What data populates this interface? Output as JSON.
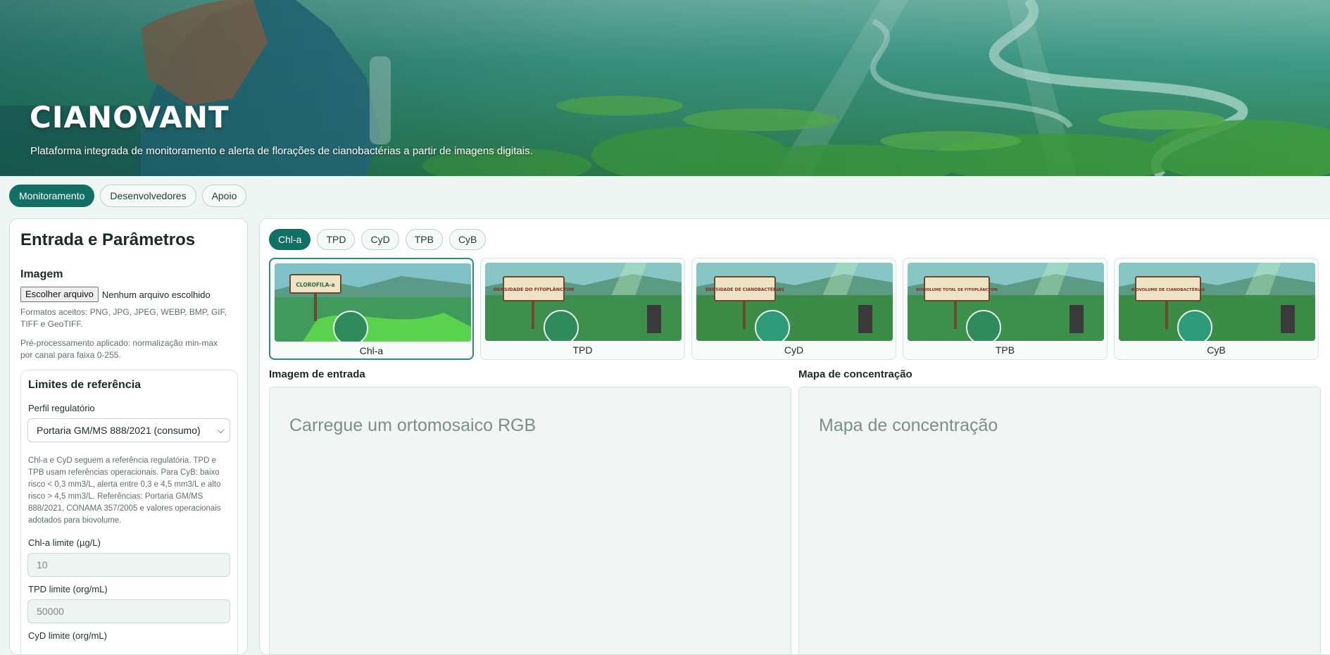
{
  "hero": {
    "title": "CIANOVANT",
    "subtitle": "Plataforma integrada de monitoramento e alerta de florações de cianobactérias a partir de imagens digitais."
  },
  "nav": {
    "tabs": [
      {
        "label": "Monitoramento",
        "active": true
      },
      {
        "label": "Desenvolvedores",
        "active": false
      },
      {
        "label": "Apoio",
        "active": false
      }
    ]
  },
  "left": {
    "title": "Entrada e Parâmetros",
    "image_section": "Imagem",
    "file_button": "Escolher arquivo",
    "file_status": "Nenhum arquivo escolhido",
    "formats_help": "Formatos aceitos: PNG, JPG, JPEG, WEBP, BMP, GIF, TIFF e GeoTIFF.",
    "preprocess_help": "Pré-processamento aplicado: normalização min-max por canal para faixa 0-255.",
    "limits": {
      "title": "Limites de referência",
      "profile_label": "Perfil regulatório",
      "profile_value": "Portaria GM/MS 888/2021 (consumo)",
      "help": "Chl-a e CyD seguem a referência regulatória. TPD e TPB usam referências operacionais. Para CyB: baixo risco < 0,3 mm3/L, alerta entre 0,3 e 4,5 mm3/L e alto risco > 4,5 mm3/L. Referências: Portaria GM/MS 888/2021, CONAMA 357/2005 e valores operacionais adotados para biovolume.",
      "chla_label": "Chl-a limite (µg/L)",
      "chla_value": "10",
      "tpd_label": "TPD limite (org/mL)",
      "tpd_value": "50000",
      "cyd_label": "CyD limite (org/mL)"
    }
  },
  "right": {
    "variable_tabs": [
      {
        "label": "Chl-a",
        "active": true
      },
      {
        "label": "TPD",
        "active": false
      },
      {
        "label": "CyD",
        "active": false
      },
      {
        "label": "TPB",
        "active": false
      },
      {
        "label": "CyB",
        "active": false
      }
    ],
    "cards": [
      {
        "label": "Chl-a",
        "sign": "CLOROFILA-a",
        "active": true
      },
      {
        "label": "TPD",
        "sign": "DENSIDADE DO FITOPLÂNCTON",
        "active": false
      },
      {
        "label": "CyD",
        "sign": "DENSIDADE DE CIANOBACTÉRIAS",
        "active": false
      },
      {
        "label": "TPB",
        "sign": "BIOVOLUME TOTAL DE FITOPLÂNCTON",
        "active": false
      },
      {
        "label": "CyB",
        "sign": "BIOVOLUME DE CIANOBACTÉRIAS",
        "active": false
      }
    ],
    "input_pane": {
      "title": "Imagem de entrada",
      "placeholder": "Carregue um ortomosaico RGB"
    },
    "map_pane": {
      "title": "Mapa de concentração",
      "placeholder": "Mapa de concentração"
    }
  },
  "colors": {
    "accent": "#126f63",
    "card_active_border": "#2c8b7d",
    "pane_bg": "#f1f6f4"
  }
}
